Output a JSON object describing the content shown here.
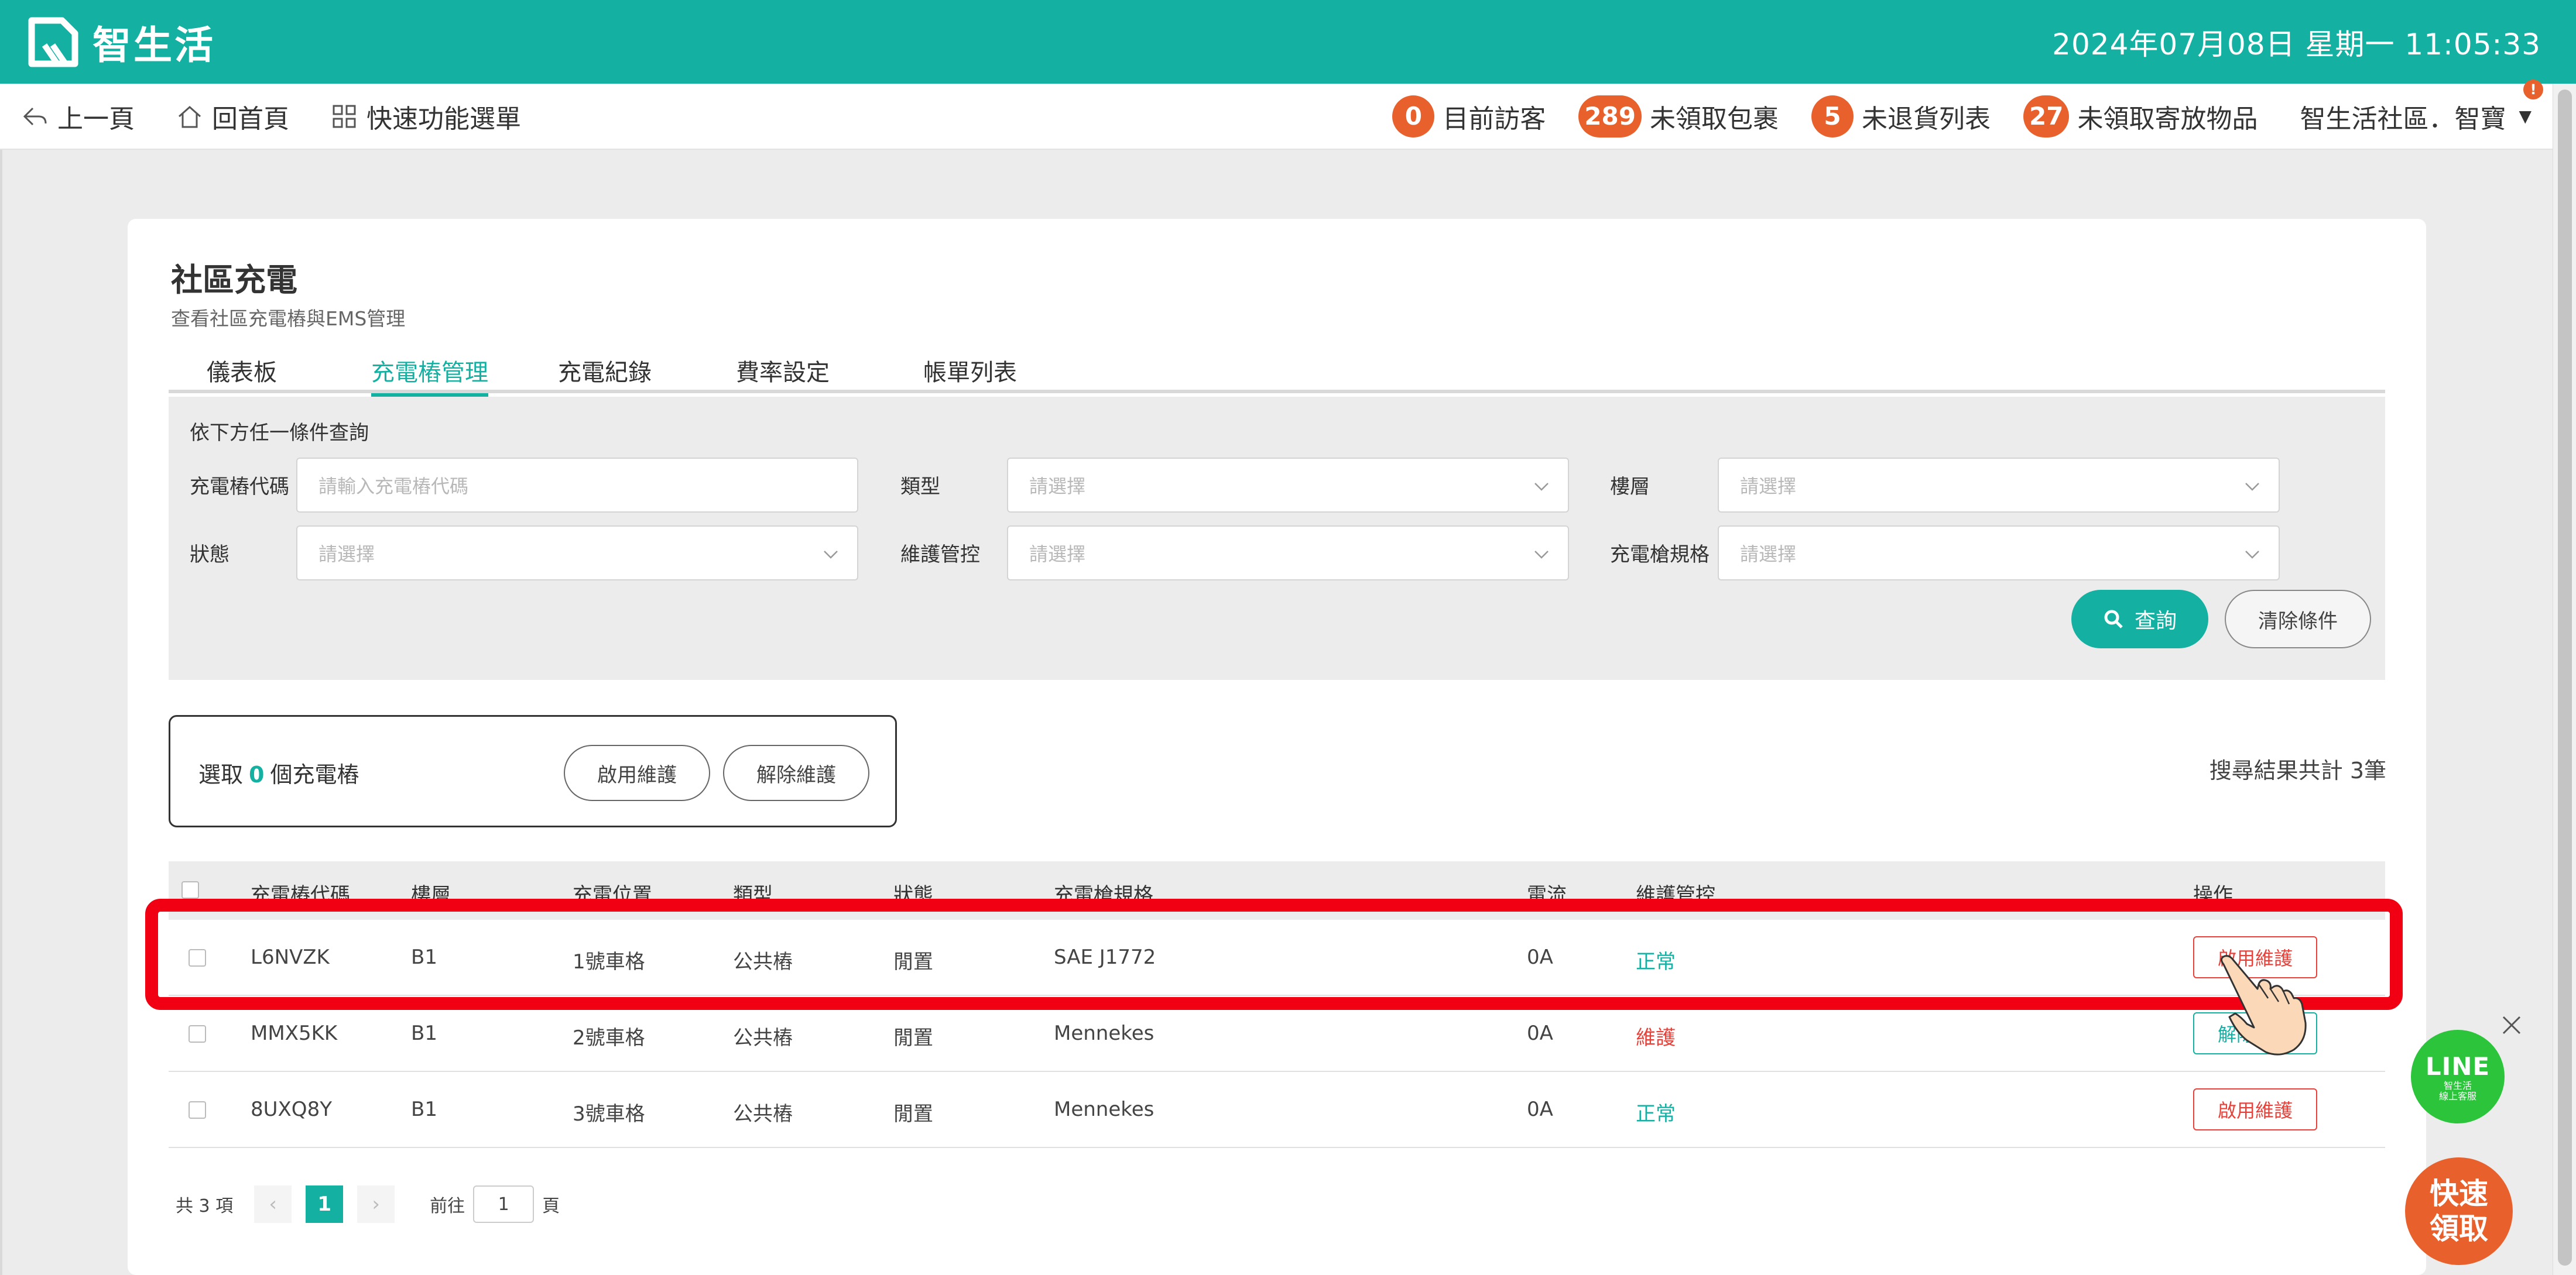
{
  "brand": {
    "name": "智生活"
  },
  "clock": "2024年07月08日 星期一 11:05:33",
  "nav": {
    "back": "上一頁",
    "home": "回首頁",
    "menu": "快速功能選單"
  },
  "stats": [
    {
      "count": "0",
      "label": "目前訪客"
    },
    {
      "count": "289",
      "label": "未領取包裹"
    },
    {
      "count": "5",
      "label": "未退貨列表"
    },
    {
      "count": "27",
      "label": "未領取寄放物品"
    }
  ],
  "user": {
    "name": "智生活社區．智寶",
    "alert": "!"
  },
  "page": {
    "title": "社區充電",
    "subtitle": "查看社區充電樁與EMS管理"
  },
  "tabs": [
    {
      "label": "儀表板",
      "active": false
    },
    {
      "label": "充電樁管理",
      "active": true
    },
    {
      "label": "充電紀錄",
      "active": false
    },
    {
      "label": "費率設定",
      "active": false
    },
    {
      "label": "帳單列表",
      "active": false
    }
  ],
  "filter": {
    "caption": "依下方任一條件查詢",
    "fields": [
      {
        "label": "充電樁代碼",
        "placeholder": "請輸入充電樁代碼"
      },
      {
        "label": "類型",
        "placeholder": "請選擇"
      },
      {
        "label": "樓層",
        "placeholder": "請選擇"
      },
      {
        "label": "狀態",
        "placeholder": "請選擇"
      },
      {
        "label": "維護管控",
        "placeholder": "請選擇"
      },
      {
        "label": "充電槍規格",
        "placeholder": "請選擇"
      }
    ],
    "search_label": "查詢",
    "clear_label": "清除條件"
  },
  "selection": {
    "prefix": "選取",
    "count": "0",
    "suffix": "個充電樁",
    "enable_label": "啟用維護",
    "disable_label": "解除維護"
  },
  "result_count": "搜尋結果共計 3筆",
  "table": {
    "headers": [
      "充電樁代碼",
      "樓層",
      "充電位置",
      "類型",
      "狀態",
      "充電槍規格",
      "電流",
      "維護管控",
      "操作"
    ],
    "rows": [
      {
        "code": "L6NVZK",
        "floor": "B1",
        "spot": "1號車格",
        "type": "公共樁",
        "status": "閒置",
        "spec": "SAE J1772",
        "current": "0A",
        "maint": "正常",
        "maint_state": "normal",
        "action": "啟用維護",
        "action_style": "red"
      },
      {
        "code": "MMX5KK",
        "floor": "B1",
        "spot": "2號車格",
        "type": "公共樁",
        "status": "閒置",
        "spec": "Mennekes",
        "current": "0A",
        "maint": "維護",
        "maint_state": "maintenance",
        "action": "解除維護",
        "action_style": "teal"
      },
      {
        "code": "8UXQ8Y",
        "floor": "B1",
        "spot": "3號車格",
        "type": "公共樁",
        "status": "閒置",
        "spec": "Mennekes",
        "current": "0A",
        "maint": "正常",
        "maint_state": "normal",
        "action": "啟用維護",
        "action_style": "red"
      }
    ]
  },
  "pagination": {
    "total": "共 3 項",
    "prev": "‹",
    "current": "1",
    "next": "›",
    "goto_prefix": "前往",
    "goto_value": "1",
    "goto_suffix": "頁"
  },
  "widgets": {
    "line_title": "LINE",
    "line_sub_1": "智生活",
    "line_sub_2": "線上客服",
    "quick_label": "快速領取"
  },
  "colors": {
    "brand": "#14b1a3",
    "badge": "#e8612c",
    "danger": "#e8413a",
    "highlight": "#f00012",
    "line": "#2bc43a"
  }
}
